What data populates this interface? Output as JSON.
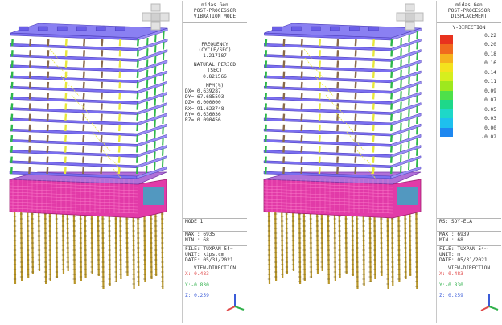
{
  "colors": {
    "slab": "#7b6ff0",
    "beam": "#8a6a4a",
    "column_green": "#2fb84a",
    "wall_yellow": "#e8e83c",
    "podium": "#e23aa8",
    "pile": "#b8962a",
    "axis_x": "#e04a4a",
    "axis_y": "#2fb04a",
    "axis_z": "#3a5bd8"
  },
  "left_panel": {
    "nav_icon": "view-cube-icon",
    "app": "midas Gen",
    "mode": "POST-PROCESSOR",
    "view": "VIBRATION MODE",
    "freq_label1": "FREQUENCY",
    "freq_label2": "(CYCLE/SEC)",
    "freq_value": "1.217187",
    "period_label1": "NATURAL PERIOD",
    "period_label2": "(SEC)",
    "period_value": "0.821566",
    "mpm_label": "MPM(%)",
    "mpm_rows": [
      "DX=   0.639287",
      "DY=  67.685593",
      "DZ=   0.000000",
      "RX=  91.623748",
      "RY=   0.636036",
      "RZ=   0.090456"
    ],
    "mode_number": "MODE 1",
    "max": "MAX : 6935",
    "min": "MIN : 68",
    "file": "FILE: TUXPAN 54~",
    "unit": "UNIT: kips.cm",
    "date": "DATE: 05/31/2021",
    "view_direction": "VIEW-DIRECTION",
    "vx": "X:-0.483",
    "vy": "Y:-0.830",
    "vz": "Z: 0.259"
  },
  "right_panel": {
    "nav_icon": "view-cube-icon",
    "app": "midas Gen",
    "mode": "POST-PROCESSOR",
    "view": "DISPLACEMENT",
    "direction": "Y-DIRECTION",
    "legend": [
      {
        "value": "0.22",
        "color": "#e8321e"
      },
      {
        "value": "0.20",
        "color": "#f06a1e"
      },
      {
        "value": "0.18",
        "color": "#f6b21e"
      },
      {
        "value": "0.16",
        "color": "#f4e21e"
      },
      {
        "value": "0.14",
        "color": "#d6ee1e"
      },
      {
        "value": "0.11",
        "color": "#9ee81e"
      },
      {
        "value": "0.09",
        "color": "#4ee04a"
      },
      {
        "value": "0.07",
        "color": "#1ed88a"
      },
      {
        "value": "0.05",
        "color": "#1ed8c8"
      },
      {
        "value": "0.03",
        "color": "#1ec0ee"
      },
      {
        "value": "0.00",
        "color": "#1e88f0"
      },
      {
        "value": "-0.02",
        "color": ""
      }
    ],
    "load_case": "RS: SDY-ELA",
    "max": "MAX : 6939",
    "min": "MIN : 68",
    "file": "FILE: TUXPAN 54~",
    "unit": "UNIT: m",
    "date": "DATE: 05/31/2021",
    "view_direction": "VIEW-DIRECTION",
    "vx": "X:-0.483",
    "vy": "Y:-0.830",
    "vz": "Z: 0.259"
  }
}
